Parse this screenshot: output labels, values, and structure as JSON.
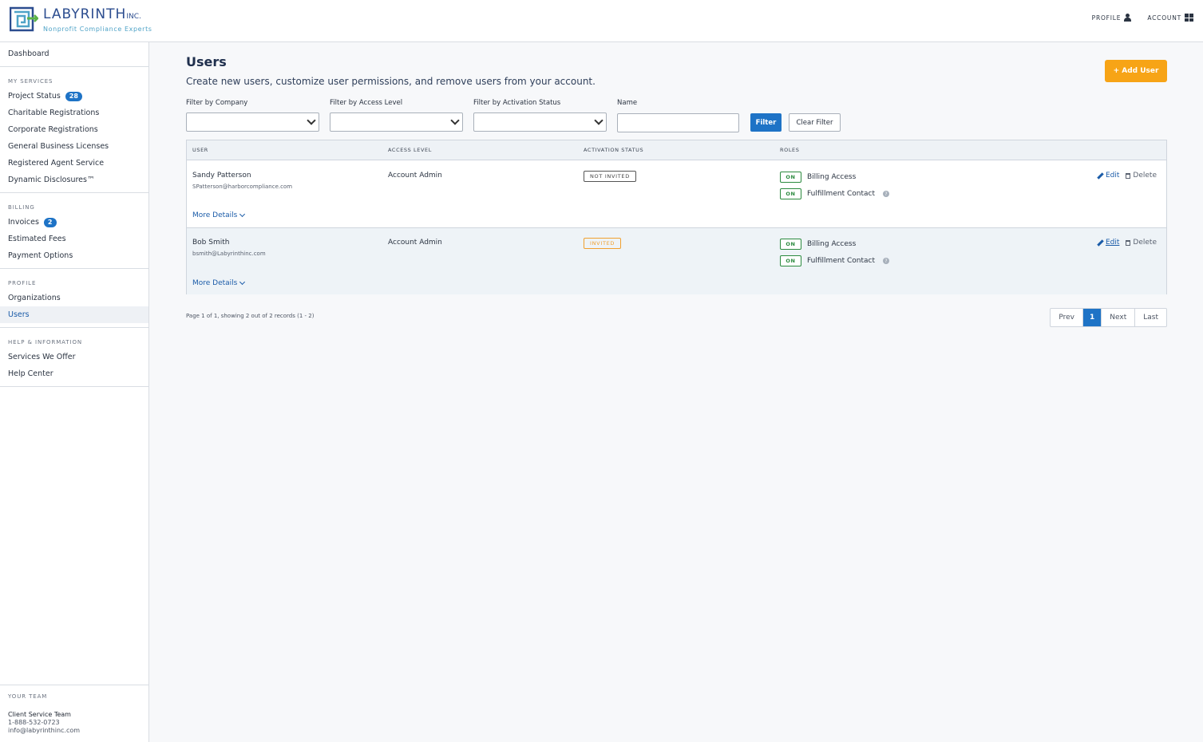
{
  "brand": {
    "name": "LABYRINTH",
    "suffix": "INC.",
    "tagline": "Nonprofit Compliance Experts"
  },
  "header_nav": {
    "profile": "PROFILE",
    "account": "ACCOUNT"
  },
  "sidebar": {
    "dashboard": "Dashboard",
    "sections": [
      {
        "heading": "MY SERVICES",
        "items": [
          {
            "label": "Project Status",
            "badge": "28"
          },
          {
            "label": "Charitable Registrations"
          },
          {
            "label": "Corporate Registrations"
          },
          {
            "label": "General Business Licenses"
          },
          {
            "label": "Registered Agent Service"
          },
          {
            "label": "Dynamic Disclosures™"
          }
        ]
      },
      {
        "heading": "BILLING",
        "items": [
          {
            "label": "Invoices",
            "badge": "2"
          },
          {
            "label": "Estimated Fees"
          },
          {
            "label": "Payment Options"
          }
        ]
      },
      {
        "heading": "PROFILE",
        "items": [
          {
            "label": "Organizations"
          },
          {
            "label": "Users"
          }
        ]
      },
      {
        "heading": "HELP & INFORMATION",
        "items": [
          {
            "label": "Services We Offer"
          },
          {
            "label": "Help Center"
          }
        ]
      }
    ],
    "team": {
      "heading": "YOUR TEAM",
      "name": "Client Service Team",
      "phone": "1-888-532-0723",
      "email": "info@labyrinthinc.com"
    }
  },
  "page": {
    "title": "Users",
    "subtitle": "Create new users, customize user permissions, and remove users from your account.",
    "add_button": "+ Add User"
  },
  "filters": {
    "company_label": "Filter by Company",
    "company_value": "",
    "access_label": "Filter by Access Level",
    "access_value": "",
    "activation_label": "Filter by Activation Status",
    "activation_value": "",
    "name_label": "Name",
    "name_value": "",
    "filter_button": "Filter",
    "clear_button": "Clear Filter"
  },
  "table": {
    "headers": [
      "USER",
      "ACCESS LEVEL",
      "ACTIVATION STATUS",
      "ROLES"
    ],
    "rows": [
      {
        "name": "Sandy Patterson",
        "email": "SPatterson@harborcompliance.com",
        "access": "Account Admin",
        "status": "NOT INVITED",
        "roles": [
          {
            "state": "ON",
            "label": "Billing Access"
          },
          {
            "state": "ON",
            "label": "Fulfillment Contact"
          }
        ],
        "more": "More Details",
        "edit": "Edit",
        "delete": "Delete"
      },
      {
        "name": "Bob Smith",
        "email": "bsmith@Labyrinthinc.com",
        "access": "Account Admin",
        "status": "INVITED",
        "roles": [
          {
            "state": "ON",
            "label": "Billing Access"
          },
          {
            "state": "ON",
            "label": "Fulfillment Contact"
          }
        ],
        "more": "More Details",
        "edit": "Edit",
        "delete": "Delete"
      }
    ]
  },
  "pagination": {
    "info": "Page 1 of 1, showing 2 out of 2 records (1 - 2)",
    "prev": "Prev",
    "current": "1",
    "next": "Next",
    "last": "Last"
  },
  "colors": {
    "brand_blue": "#1e73c6",
    "accent_orange": "#f7a416",
    "on_green": "#2b8a3e",
    "invited_orange": "#f0a030"
  }
}
